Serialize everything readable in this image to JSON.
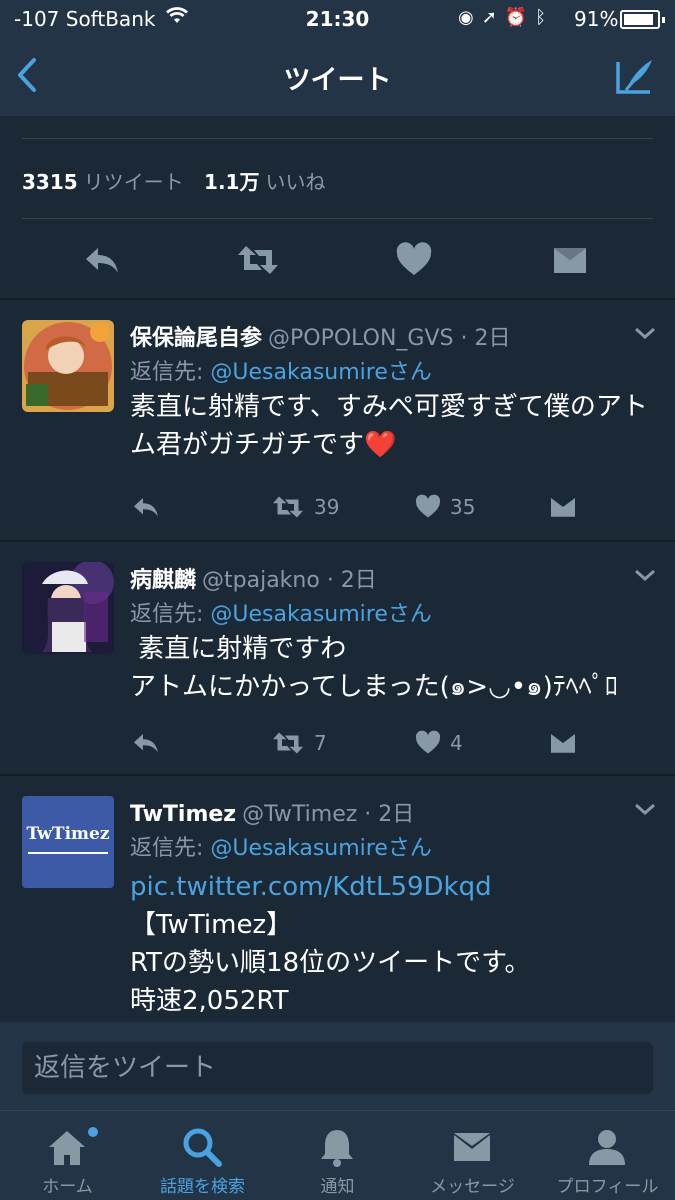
{
  "status": {
    "carrier": "-107 SoftBank",
    "time": "21:30",
    "battery_pct": "91%",
    "battery_level": 0.91
  },
  "nav": {
    "title": "ツイート"
  },
  "stats": {
    "retweet_count": "3315",
    "retweet_label": "リツイート",
    "like_count": "1.1万",
    "like_label": "いいね"
  },
  "tweets": [
    {
      "name": "保保論尾自参",
      "handle": "@POPOLON_GVS · 2日",
      "reply_prefix": "返信先:",
      "reply_to": "@Uesakasumire",
      "reply_suffix": "さん",
      "text": "素直に射精です、すみぺ可愛すぎて僕のアトム君がガチガチです❤️",
      "retweets": "39",
      "likes": "35"
    },
    {
      "name": "病麒麟",
      "handle": "@tpajakno · 2日",
      "reply_prefix": "返信先:",
      "reply_to": "@Uesakasumire",
      "reply_suffix": "さん",
      "text_line1": " 素直に射精ですわ",
      "text_line2": "アトムにかかってしまった(๑>◡•๑)ﾃﾍﾍﾟﾛ",
      "retweets": "7",
      "likes": "4"
    },
    {
      "name": "TwTimez",
      "handle": "@TwTimez · 2日",
      "reply_prefix": "返信先:",
      "reply_to": "@Uesakasumire",
      "reply_suffix": "さん",
      "avatar_text": "TwTimez",
      "link": "pic.twitter.com/KdtL59Dkqd",
      "line2": "【TwTimez】",
      "line3": "RTの勢い順18位のツイートです。",
      "line4": "時速2,052RT"
    }
  ],
  "reply_bar": {
    "placeholder": "返信をツイート"
  },
  "tabs": [
    {
      "label": "ホーム"
    },
    {
      "label": "話題を検索"
    },
    {
      "label": "通知"
    },
    {
      "label": "メッセージ"
    },
    {
      "label": "プロフィール"
    }
  ],
  "colors": {
    "accent": "#4aa3df",
    "background": "#1b2836",
    "bar": "#243447",
    "muted": "#8899a6"
  }
}
